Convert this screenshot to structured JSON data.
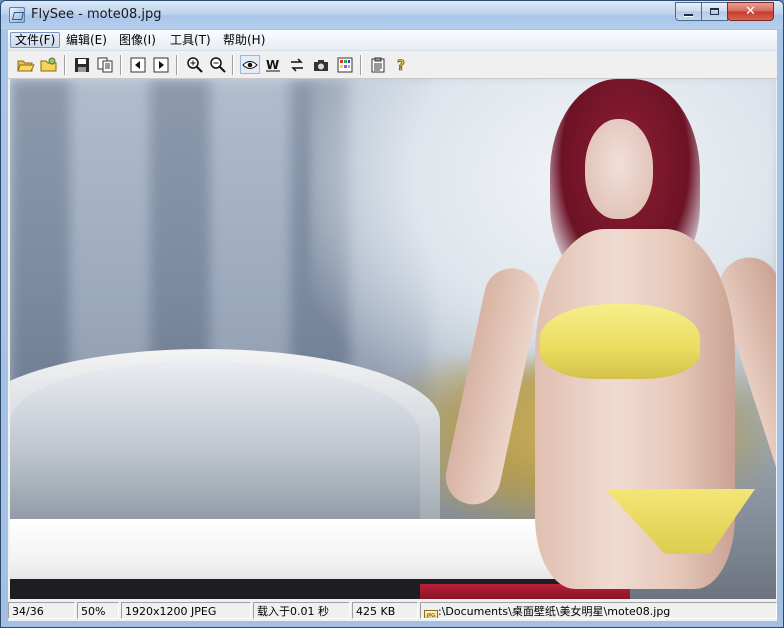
{
  "window": {
    "title": "FlySee - mote08.jpg"
  },
  "menu": [
    {
      "label": "文件(F)",
      "active": true
    },
    {
      "label": "编辑(E)"
    },
    {
      "label": "图像(I)"
    },
    {
      "label": "工具(T)"
    },
    {
      "label": "帮助(H)"
    }
  ],
  "toolbar": {
    "buttons": [
      "open-folder-icon",
      "browse-folder-icon",
      "save-icon",
      "copy-icon",
      "previous-icon",
      "next-icon",
      "zoom-in-icon",
      "zoom-out-icon",
      "view-eye-icon",
      "wallpaper-icon",
      "rotate-icon",
      "camera-icon",
      "palette-icon",
      "properties-icon",
      "help-icon"
    ]
  },
  "status": {
    "index": "34/36",
    "zoom": "50%",
    "dimensions": "1920x1200 JPEG",
    "load_time": "载入于0.01 秒",
    "file_size": "425 KB",
    "path": ":\\Documents\\桌面壁纸\\美女明星\\mote08.jpg"
  },
  "colors": {
    "accent": "#2c4a6e",
    "close_button": "#c2392b"
  }
}
